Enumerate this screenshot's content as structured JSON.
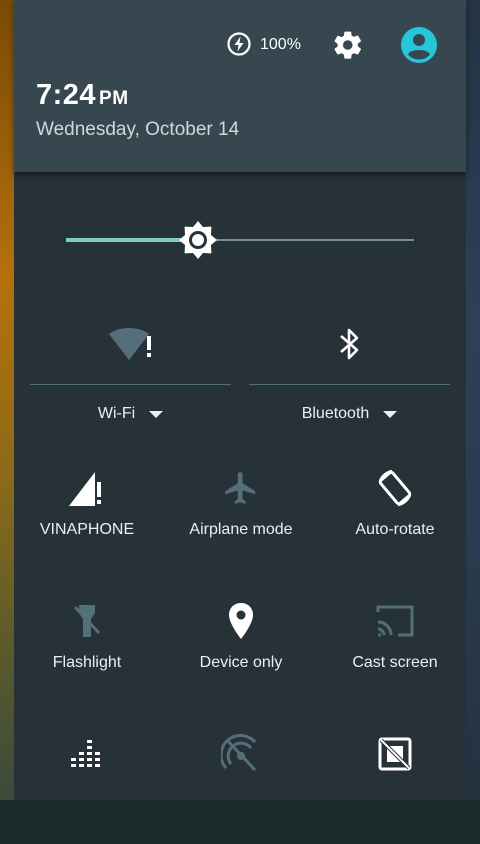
{
  "status": {
    "battery_percent": "100%",
    "time": "7:24",
    "ampm": "PM",
    "date": "Wednesday, October 14"
  },
  "brightness": {
    "level_fraction": 0.38
  },
  "large_tiles": [
    {
      "label": "Wi-Fi",
      "icon": "wifi-warning-icon",
      "has_dropdown": true
    },
    {
      "label": "Bluetooth",
      "icon": "bluetooth-icon",
      "has_dropdown": true
    }
  ],
  "tiles": [
    {
      "label": "VINAPHONE",
      "icon": "cell-signal-warning-icon",
      "active": true
    },
    {
      "label": "Airplane mode",
      "icon": "airplane-icon",
      "active": false
    },
    {
      "label": "Auto-rotate",
      "icon": "auto-rotate-icon",
      "active": true
    },
    {
      "label": "Flashlight",
      "icon": "flashlight-icon",
      "active": false
    },
    {
      "label": "Device only",
      "icon": "location-icon",
      "active": true
    },
    {
      "label": "Cast screen",
      "icon": "cast-icon",
      "active": false
    },
    {
      "label": "",
      "icon": "audio-fx-icon",
      "active": true
    },
    {
      "label": "",
      "icon": "hotspot-off-icon",
      "active": false
    },
    {
      "label": "",
      "icon": "sd-card-off-icon",
      "active": true
    }
  ],
  "colors": {
    "accent": "#80cbc4",
    "header_bg": "#37474f",
    "panel_bg": "#263238",
    "inactive_icon": "#546e7a",
    "active_icon": "#ffffff"
  }
}
